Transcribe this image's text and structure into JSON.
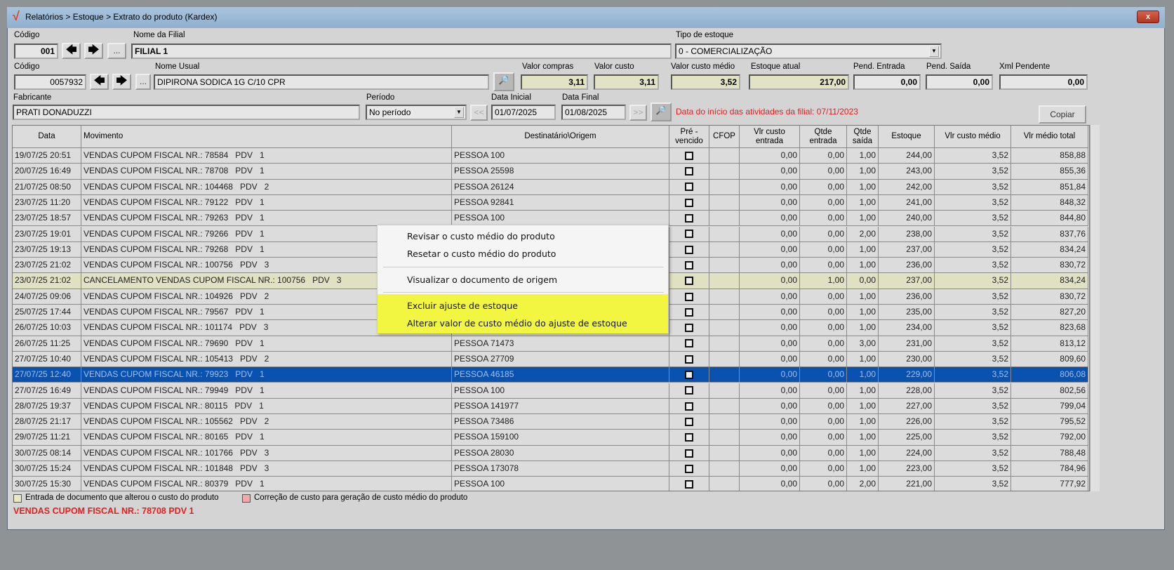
{
  "window": {
    "title": "Relatórios > Estoque > Extrato do produto (Kardex)",
    "close": "x",
    "logo": "√"
  },
  "filial": {
    "codigo_label": "Código",
    "codigo": "001",
    "nome_label": "Nome da Filial",
    "nome": "FILIAL 1",
    "tipo_label": "Tipo de estoque",
    "tipo": "0 - COMERCIALIZAÇÃO"
  },
  "produto": {
    "codigo_label": "Código",
    "codigo": "0057932",
    "nome_label": "Nome Usual",
    "nome": "DIPIRONA SODICA 1G C/10 CPR",
    "valor_compras_label": "Valor compras",
    "valor_compras": "3,11",
    "valor_custo_label": "Valor custo",
    "valor_custo": "3,11",
    "valor_custo_medio_label": "Valor custo médio",
    "valor_custo_medio": "3,52",
    "estoque_atual_label": "Estoque atual",
    "estoque_atual": "217,00",
    "pend_entrada_label": "Pend. Entrada",
    "pend_entrada": "0,00",
    "pend_saida_label": "Pend. Saída",
    "pend_saida": "0,00",
    "xml_label": "Xml Pendente",
    "xml": "0,00"
  },
  "filtros": {
    "fabricante_label": "Fabricante",
    "fabricante": "PRATI DONADUZZI",
    "periodo_label": "Período",
    "periodo": "No período",
    "data_inicial_label": "Data Inicial",
    "data_inicial": "01/07/2025",
    "data_final_label": "Data Final",
    "data_final": "01/08/2025",
    "prev": "<<",
    "next": ">>",
    "ellipsis": "...",
    "aviso": "Data do início das atividades da filial: 07/11/2023",
    "copiar": "Copiar"
  },
  "columns": [
    "Data",
    "Movimento",
    "Destinatário\\Origem",
    "Pré - vencido",
    "CFOP",
    "Vlr custo entrada",
    "Qtde entrada",
    "Qtde saída",
    "Estoque",
    "Vlr custo médio",
    "Vlr médio total"
  ],
  "rows": [
    [
      "19/07/25 20:51",
      "VENDAS CUPOM FISCAL NR.: 78584   PDV   1",
      "PESSOA 100",
      "",
      "0,00",
      "0,00",
      "1,00",
      "244,00",
      "3,52",
      "858,88"
    ],
    [
      "20/07/25 16:49",
      "VENDAS CUPOM FISCAL NR.: 78708   PDV   1",
      "PESSOA 25598",
      "",
      "0,00",
      "0,00",
      "1,00",
      "243,00",
      "3,52",
      "855,36"
    ],
    [
      "21/07/25 08:50",
      "VENDAS CUPOM FISCAL NR.: 104468   PDV   2",
      "PESSOA 26124",
      "",
      "0,00",
      "0,00",
      "1,00",
      "242,00",
      "3,52",
      "851,84"
    ],
    [
      "23/07/25 11:20",
      "VENDAS CUPOM FISCAL NR.: 79122   PDV   1",
      "PESSOA 92841",
      "",
      "0,00",
      "0,00",
      "1,00",
      "241,00",
      "3,52",
      "848,32"
    ],
    [
      "23/07/25 18:57",
      "VENDAS CUPOM FISCAL NR.: 79263   PDV   1",
      "PESSOA 100",
      "",
      "0,00",
      "0,00",
      "1,00",
      "240,00",
      "3,52",
      "844,80"
    ],
    [
      "23/07/25 19:01",
      "VENDAS CUPOM FISCAL NR.: 79266   PDV   1",
      "",
      "",
      "0,00",
      "0,00",
      "2,00",
      "238,00",
      "3,52",
      "837,76"
    ],
    [
      "23/07/25 19:13",
      "VENDAS CUPOM FISCAL NR.: 79268   PDV   1",
      "",
      "",
      "0,00",
      "0,00",
      "1,00",
      "237,00",
      "3,52",
      "834,24"
    ],
    [
      "23/07/25 21:02",
      "VENDAS CUPOM FISCAL NR.: 100756   PDV   3",
      "",
      "",
      "0,00",
      "0,00",
      "1,00",
      "236,00",
      "3,52",
      "830,72"
    ],
    [
      "23/07/25 21:02",
      "CANCELAMENTO VENDAS CUPOM FISCAL NR.: 100756   PDV   3",
      "",
      "",
      "0,00",
      "1,00",
      "0,00",
      "237,00",
      "3,52",
      "834,24"
    ],
    [
      "24/07/25 09:06",
      "VENDAS CUPOM FISCAL NR.: 104926   PDV   2",
      "",
      "",
      "0,00",
      "0,00",
      "1,00",
      "236,00",
      "3,52",
      "830,72"
    ],
    [
      "25/07/25 17:44",
      "VENDAS CUPOM FISCAL NR.: 79567   PDV   1",
      "",
      "",
      "0,00",
      "0,00",
      "1,00",
      "235,00",
      "3,52",
      "827,20"
    ],
    [
      "26/07/25 10:03",
      "VENDAS CUPOM FISCAL NR.: 101174   PDV   3",
      "",
      "",
      "0,00",
      "0,00",
      "1,00",
      "234,00",
      "3,52",
      "823,68"
    ],
    [
      "26/07/25 11:25",
      "VENDAS CUPOM FISCAL NR.: 79690   PDV   1",
      "PESSOA 71473",
      "",
      "0,00",
      "0,00",
      "3,00",
      "231,00",
      "3,52",
      "813,12"
    ],
    [
      "27/07/25 10:40",
      "VENDAS CUPOM FISCAL NR.: 105413   PDV   2",
      "PESSOA 27709",
      "",
      "0,00",
      "0,00",
      "1,00",
      "230,00",
      "3,52",
      "809,60"
    ],
    [
      "27/07/25 12:40",
      "VENDAS CUPOM FISCAL NR.: 79923   PDV   1",
      "PESSOA 46185",
      "",
      "0,00",
      "0,00",
      "1,00",
      "229,00",
      "3,52",
      "806,08"
    ],
    [
      "27/07/25 16:49",
      "VENDAS CUPOM FISCAL NR.: 79949   PDV   1",
      "PESSOA 100",
      "",
      "0,00",
      "0,00",
      "1,00",
      "228,00",
      "3,52",
      "802,56"
    ],
    [
      "28/07/25 19:37",
      "VENDAS CUPOM FISCAL NR.: 80115   PDV   1",
      "PESSOA 141977",
      "",
      "0,00",
      "0,00",
      "1,00",
      "227,00",
      "3,52",
      "799,04"
    ],
    [
      "28/07/25 21:17",
      "VENDAS CUPOM FISCAL NR.: 105562   PDV   2",
      "PESSOA 73486",
      "",
      "0,00",
      "0,00",
      "1,00",
      "226,00",
      "3,52",
      "795,52"
    ],
    [
      "29/07/25 11:21",
      "VENDAS CUPOM FISCAL NR.: 80165   PDV   1",
      "PESSOA 159100",
      "",
      "0,00",
      "0,00",
      "1,00",
      "225,00",
      "3,52",
      "792,00"
    ],
    [
      "30/07/25 08:14",
      "VENDAS CUPOM FISCAL NR.: 101766   PDV   3",
      "PESSOA 28030",
      "",
      "0,00",
      "0,00",
      "1,00",
      "224,00",
      "3,52",
      "788,48"
    ],
    [
      "30/07/25 15:24",
      "VENDAS CUPOM FISCAL NR.: 101848   PDV   3",
      "PESSOA 173078",
      "",
      "0,00",
      "0,00",
      "1,00",
      "223,00",
      "3,52",
      "784,96"
    ],
    [
      "30/07/25 15:30",
      "VENDAS CUPOM FISCAL NR.: 80379   PDV   1",
      "PESSOA 100",
      "",
      "0,00",
      "0,00",
      "2,00",
      "221,00",
      "3,52",
      "777,92"
    ]
  ],
  "selected_row": 14,
  "cancel_row": 8,
  "menu": [
    "Revisar o custo médio do produto",
    "Resetar o custo médio do produto",
    "Visualizar o documento de origem",
    "Excluir ajuste de estoque",
    "Alterar valor de custo médio do ajuste de estoque"
  ],
  "legend": [
    "Entrada de documento que alterou o custo do produto",
    "Correção de custo para geração de custo médio do produto"
  ],
  "status": "VENDAS CUPOM FISCAL NR.: 78708   PDV   1",
  "colors": {
    "selection": "#0a52b0",
    "cancel_row": "#e0e0c2",
    "highlight": "#f2f640",
    "alert": "#e02020"
  }
}
